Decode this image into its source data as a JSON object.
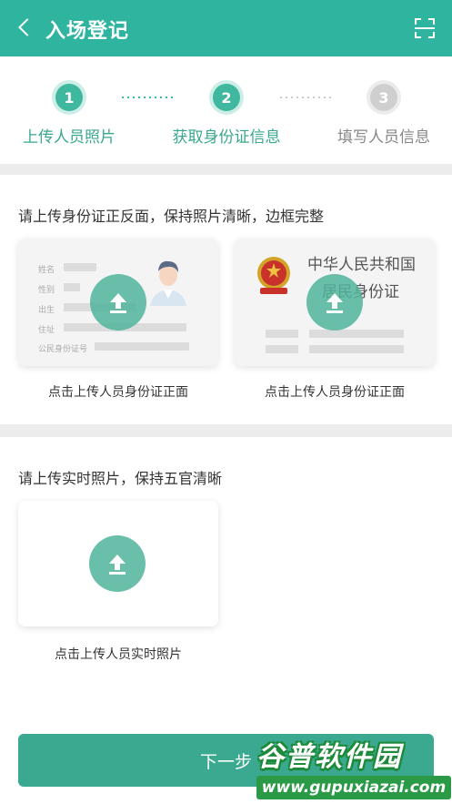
{
  "header": {
    "title": "入场登记",
    "back_icon": "chevron-left-icon",
    "scan_icon": "scan-icon",
    "bg_color": "#2fb4a0"
  },
  "steps": [
    {
      "number": "1",
      "label": "上传人员照片",
      "state": "done"
    },
    {
      "number": "2",
      "label": "获取身份证信息",
      "state": "active"
    },
    {
      "number": "3",
      "label": "填写人员信息",
      "state": "inactive"
    }
  ],
  "id_section": {
    "title": "请上传身份证正反面，保持照片清晰，边框完整",
    "front": {
      "fields": [
        "姓名",
        "性别",
        "出生",
        "住址",
        "公民身份证号"
      ],
      "caption": "点击上传人员身份证正面"
    },
    "back": {
      "country": "中华人民共和国",
      "card_name": "居民身份证",
      "caption": "点击上传人员身份证正面"
    }
  },
  "photo_section": {
    "title": "请上传实时照片，保持五官清晰",
    "caption": "点击上传人员实时照片"
  },
  "next_button": {
    "label": "下一步"
  },
  "watermark": {
    "main": "谷普软件园",
    "url": "www.gupuxiazai.com"
  },
  "colors": {
    "accent": "#3aa98f",
    "upload_circle": "#50b49b"
  }
}
